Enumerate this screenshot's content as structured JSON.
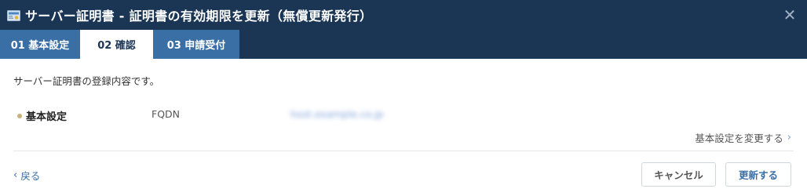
{
  "window": {
    "title": "サーバー証明書 - 証明書の有効期限を更新（無償更新発行）",
    "icon": "certificate-icon",
    "close_glyph": "✕"
  },
  "tabs": [
    {
      "label": "01 基本設定",
      "active": false
    },
    {
      "label": "02 確認",
      "active": true
    },
    {
      "label": "03 申請受付",
      "active": false
    }
  ],
  "main": {
    "intro": "サーバー証明書の登録内容です。",
    "section_label": "基本設定",
    "field_key": "FQDN",
    "field_value": "host.example.co.jp",
    "change_link": "基本設定を変更する",
    "change_chevron": "›"
  },
  "footer": {
    "back_chevron": "‹",
    "back_label": "戻る",
    "cancel_label": "キャンセル",
    "update_label": "更新する"
  },
  "colors": {
    "header_bg": "#1b3554",
    "tab_bg": "#3a6fa6",
    "accent": "#3a6fa6",
    "bullet": "#c9b27a"
  }
}
